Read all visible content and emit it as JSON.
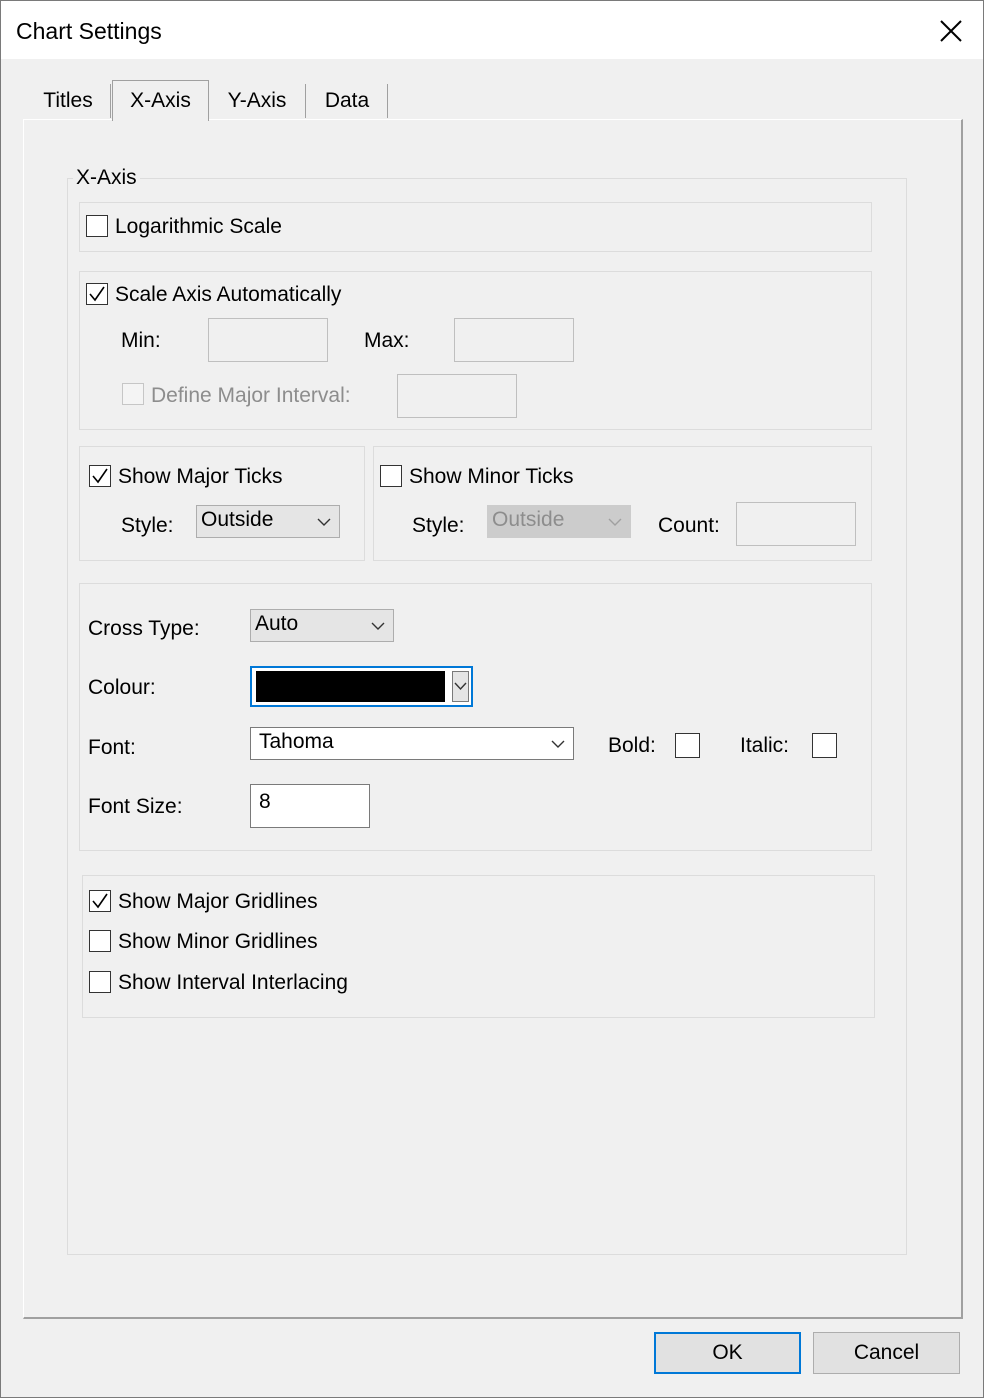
{
  "window": {
    "title": "Chart Settings"
  },
  "tabs": [
    {
      "label": "Titles"
    },
    {
      "label": "X-Axis",
      "active": true
    },
    {
      "label": "Y-Axis"
    },
    {
      "label": "Data"
    }
  ],
  "group": {
    "legend": "X-Axis"
  },
  "logarithmic": {
    "label": "Logarithmic Scale",
    "checked": false
  },
  "scale": {
    "auto_label": "Scale Axis Automatically",
    "auto_checked": true,
    "min_label": "Min:",
    "min_value": "",
    "max_label": "Max:",
    "max_value": "",
    "interval_label": "Define Major Interval:",
    "interval_checked": false,
    "interval_value": ""
  },
  "major_ticks": {
    "label": "Show Major Ticks",
    "checked": true,
    "style_label": "Style:",
    "style_value": "Outside"
  },
  "minor_ticks": {
    "label": "Show Minor Ticks",
    "checked": false,
    "style_label": "Style:",
    "style_value": "Outside",
    "count_label": "Count:",
    "count_value": ""
  },
  "appearance": {
    "cross_type_label": "Cross Type:",
    "cross_type_value": "Auto",
    "colour_label": "Colour:",
    "colour_value": "#000000",
    "font_label": "Font:",
    "font_value": "Tahoma",
    "bold_label": "Bold:",
    "bold_checked": false,
    "italic_label": "Italic:",
    "italic_checked": false,
    "font_size_label": "Font Size:",
    "font_size_value": "8"
  },
  "gridlines": {
    "major_label": "Show Major Gridlines",
    "major_checked": true,
    "minor_label": "Show Minor Gridlines",
    "minor_checked": false,
    "interlacing_label": "Show Interval Interlacing",
    "interlacing_checked": false
  },
  "buttons": {
    "ok": "OK",
    "cancel": "Cancel"
  },
  "icons": {
    "close": "close-icon",
    "check": "check-icon",
    "dropdown": "chevron-down-icon"
  },
  "colors": {
    "accent": "#0078d7",
    "panel": "#f0f0f0"
  }
}
